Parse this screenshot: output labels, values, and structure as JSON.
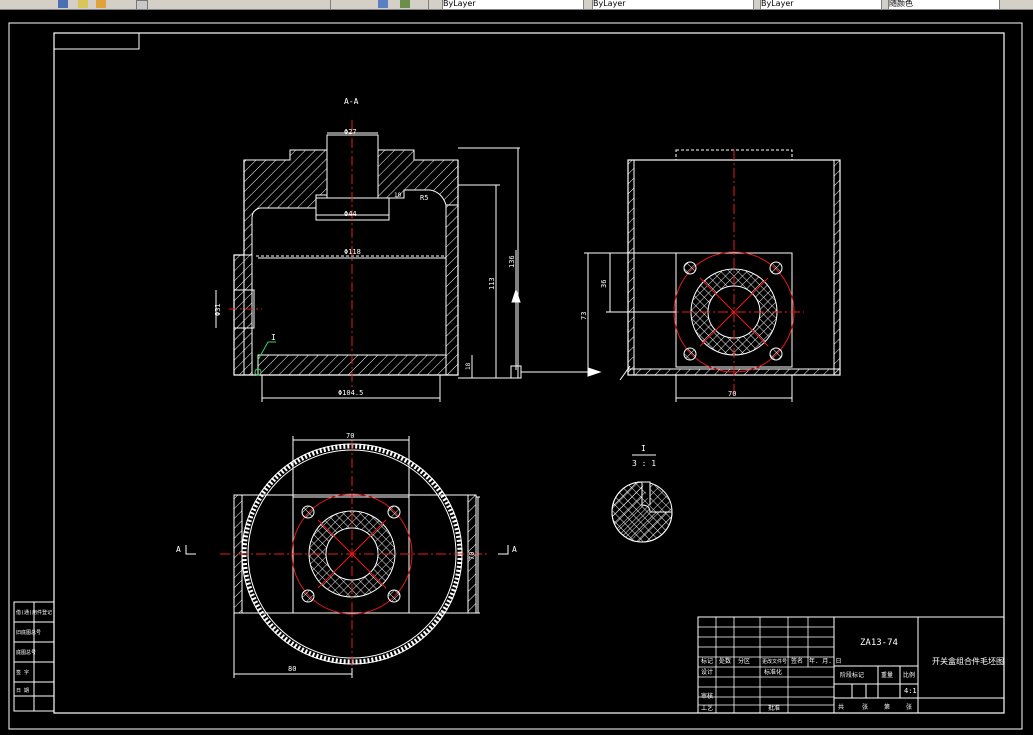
{
  "toolbar": {
    "layer_combo": "ByLayer",
    "linetype_combo": "ByLayer",
    "lineweight_combo": "ByLayer",
    "color_combo": "随颜色"
  },
  "colors": {
    "outline": "#ffffff",
    "center": "#e41b1b",
    "hatch": "#ffffff",
    "background": "#000000",
    "dim_green": "#3cd35c"
  },
  "drawing": {
    "section_label": "A-A",
    "dims": {
      "d27": "Φ27",
      "d44": "Φ44",
      "d118": "Φ118",
      "d104_5": "Φ104.5",
      "d31": "Φ31",
      "h113": "113",
      "h136": "136",
      "h10": "10",
      "h18": "18",
      "r5": "R5",
      "w70_top": "70",
      "w70_front": "70",
      "h70": "70",
      "h36": "36",
      "h73": "73",
      "w80": "80"
    },
    "detail_label": "I",
    "detail_ref": "I",
    "detail_scale": "3 : 1",
    "cut_a_left": "A",
    "cut_a_right": "A"
  },
  "title_block": {
    "drawing_no": "ZA13-74",
    "name": "开关盒组合件毛坯图",
    "scale": "4:1",
    "headers_row": [
      "标记",
      "处数",
      "分区",
      "更改文件号",
      "签名",
      "年. 月. 日"
    ],
    "design": "设计",
    "standardize": "标准化",
    "stage_mark": "阶段标记",
    "weight": "重量",
    "ratio": "比例",
    "check": "审核",
    "process": "工艺",
    "approve": "批准",
    "sheets": [
      "共",
      "张",
      "第",
      "张"
    ]
  },
  "left_stamp": {
    "rows": [
      "借(通)用件登记",
      "旧底图总号",
      "底图总号",
      "签 字",
      "日 期"
    ]
  }
}
